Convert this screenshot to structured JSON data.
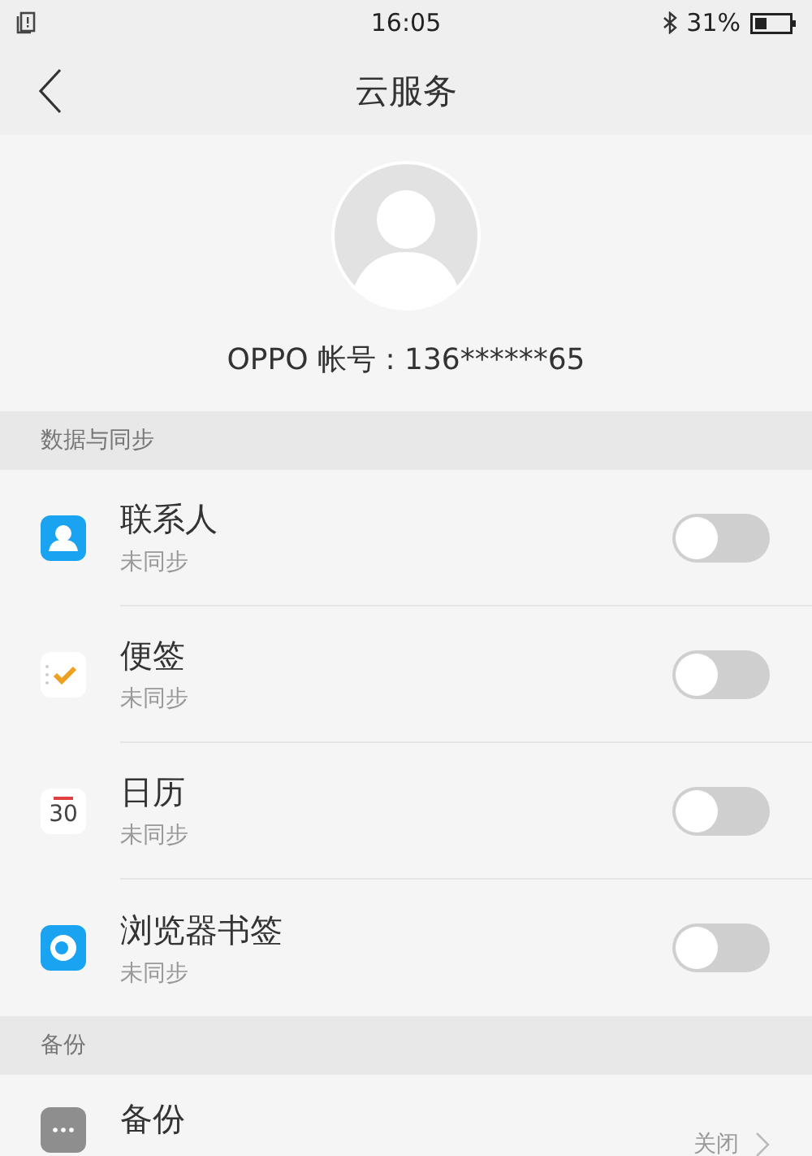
{
  "status_bar": {
    "time": "16:05",
    "battery": "31%"
  },
  "header": {
    "title": "云服务"
  },
  "account": {
    "label": "OPPO 帐号 : 136******65"
  },
  "sections": [
    {
      "title": "数据与同步",
      "items": [
        {
          "kind": "toggle",
          "title": "联系人",
          "subtitle": "未同步",
          "on": false
        },
        {
          "kind": "toggle",
          "title": "便签",
          "subtitle": "未同步",
          "on": false
        },
        {
          "kind": "toggle",
          "title": "日历",
          "subtitle": "未同步",
          "on": false,
          "icon_number": "30"
        },
        {
          "kind": "toggle",
          "title": "浏览器书签",
          "subtitle": "未同步",
          "on": false
        }
      ]
    },
    {
      "title": "备份",
      "items": [
        {
          "kind": "link",
          "title": "备份",
          "value": "关闭"
        }
      ]
    }
  ]
}
